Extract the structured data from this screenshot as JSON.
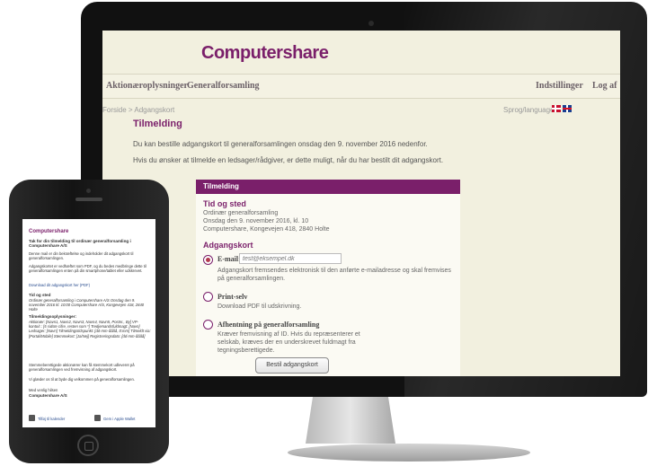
{
  "desktop": {
    "logo": "Computershare",
    "nav": {
      "aktionaer": "Aktionærop­lysninger",
      "generalforsamling": "Generalforsamling",
      "indstillinger": "Indstillinger",
      "logaf": "Log af"
    },
    "breadcrumb": "Forside > Adgangskort",
    "language_label": "Sprog/language",
    "page_title": "Tilmelding",
    "intro_1": "Du kan bestille adgangskort til generalforsamlingen onsdag den 9. november 2016 nedenfor.",
    "intro_2": "Hvis du ønsker at tilmelde en ledsager/rådgiver, er dette muligt, når du har bestilt dit adgangskort.",
    "panel": {
      "header": "Tilmelding",
      "place_title": "Tid og sted",
      "place_lines": [
        "Ordinær generalforsamling",
        "Onsdag den 9. november 2016, kl. 10",
        "Computershare, Kongevejen 418, 2840 Holte"
      ],
      "card_title": "Adgangskort",
      "option_email": {
        "label": "E-mail:",
        "placeholder": "test@eksempel.dk",
        "desc": "Adgangskort fremsendes elektronisk til den anførte e-mailadresse og skal fremvises på generalforsamlingen."
      },
      "option_print": {
        "label": "Print-selv",
        "desc": "Download PDF til udskrivning."
      },
      "option_pickup": {
        "label": "Afhentning på generalforsamling",
        "desc": "Kræver fremvisning af ID. Hvis du repræsenterer et selskab, kræves der en underskrevet fuldmagt fra tegningsberettigede."
      },
      "submit": "Bestil adgangskort"
    }
  },
  "mobile": {
    "logo": "Computershare",
    "thanks": "Tak for din tilmelding til ordinær generalforsamling i Computershare A/S",
    "p1": "Denne mail er din bekræftelse og indeholder dit adgangskort til generalforsamlingen.",
    "p2": "Adgangskortet er vedhæftet som PDF, og du bedes medbringe dette til generalforsamlingen enten på din smartphone/tablet eller udskrevet.",
    "download_link": "Download dit adgangskort her (PDF)",
    "place_title": "Tid og sted",
    "place_text": "Ordinær generalforsamling i Computershare A/S Onsdag den 9. november 2016 kl. 10:00 Computershare A/S, Kongevejen 418, 2840 Holte",
    "reg_title": "Tilmeldingsoplysninger:",
    "reg_text": "Aktionær: [Navn1, Navn2, Navn3, Navn4, Navn5, Postnr., By] VP-konto/r.: [5 sidste cifre, resten som *] Tredjemandsfuldmagt: [Navn] Ledsager: [Navn] Tilmeldingstidspunkt: [dd-mm-åååå, tt:mm] Tilmeldt via: [Portal/Mobile] Stemmekort: [Ja/Nej] Registreringsdato: [dd-mm-åååå]",
    "p3": "Stemmeberettigede aktionærer kan få stemmekort udleveret på generalforsamlingen ved fremvisning af adgangskort.",
    "p4": "Vi glæder os til at byde dig velkommen på generalforsamlingen.",
    "regards": "Med venlig hilsen",
    "company": "Computershare A/S",
    "footer_calendar": "Tilføj til kalender",
    "footer_wallet": "Gem i Apple Wallet"
  }
}
